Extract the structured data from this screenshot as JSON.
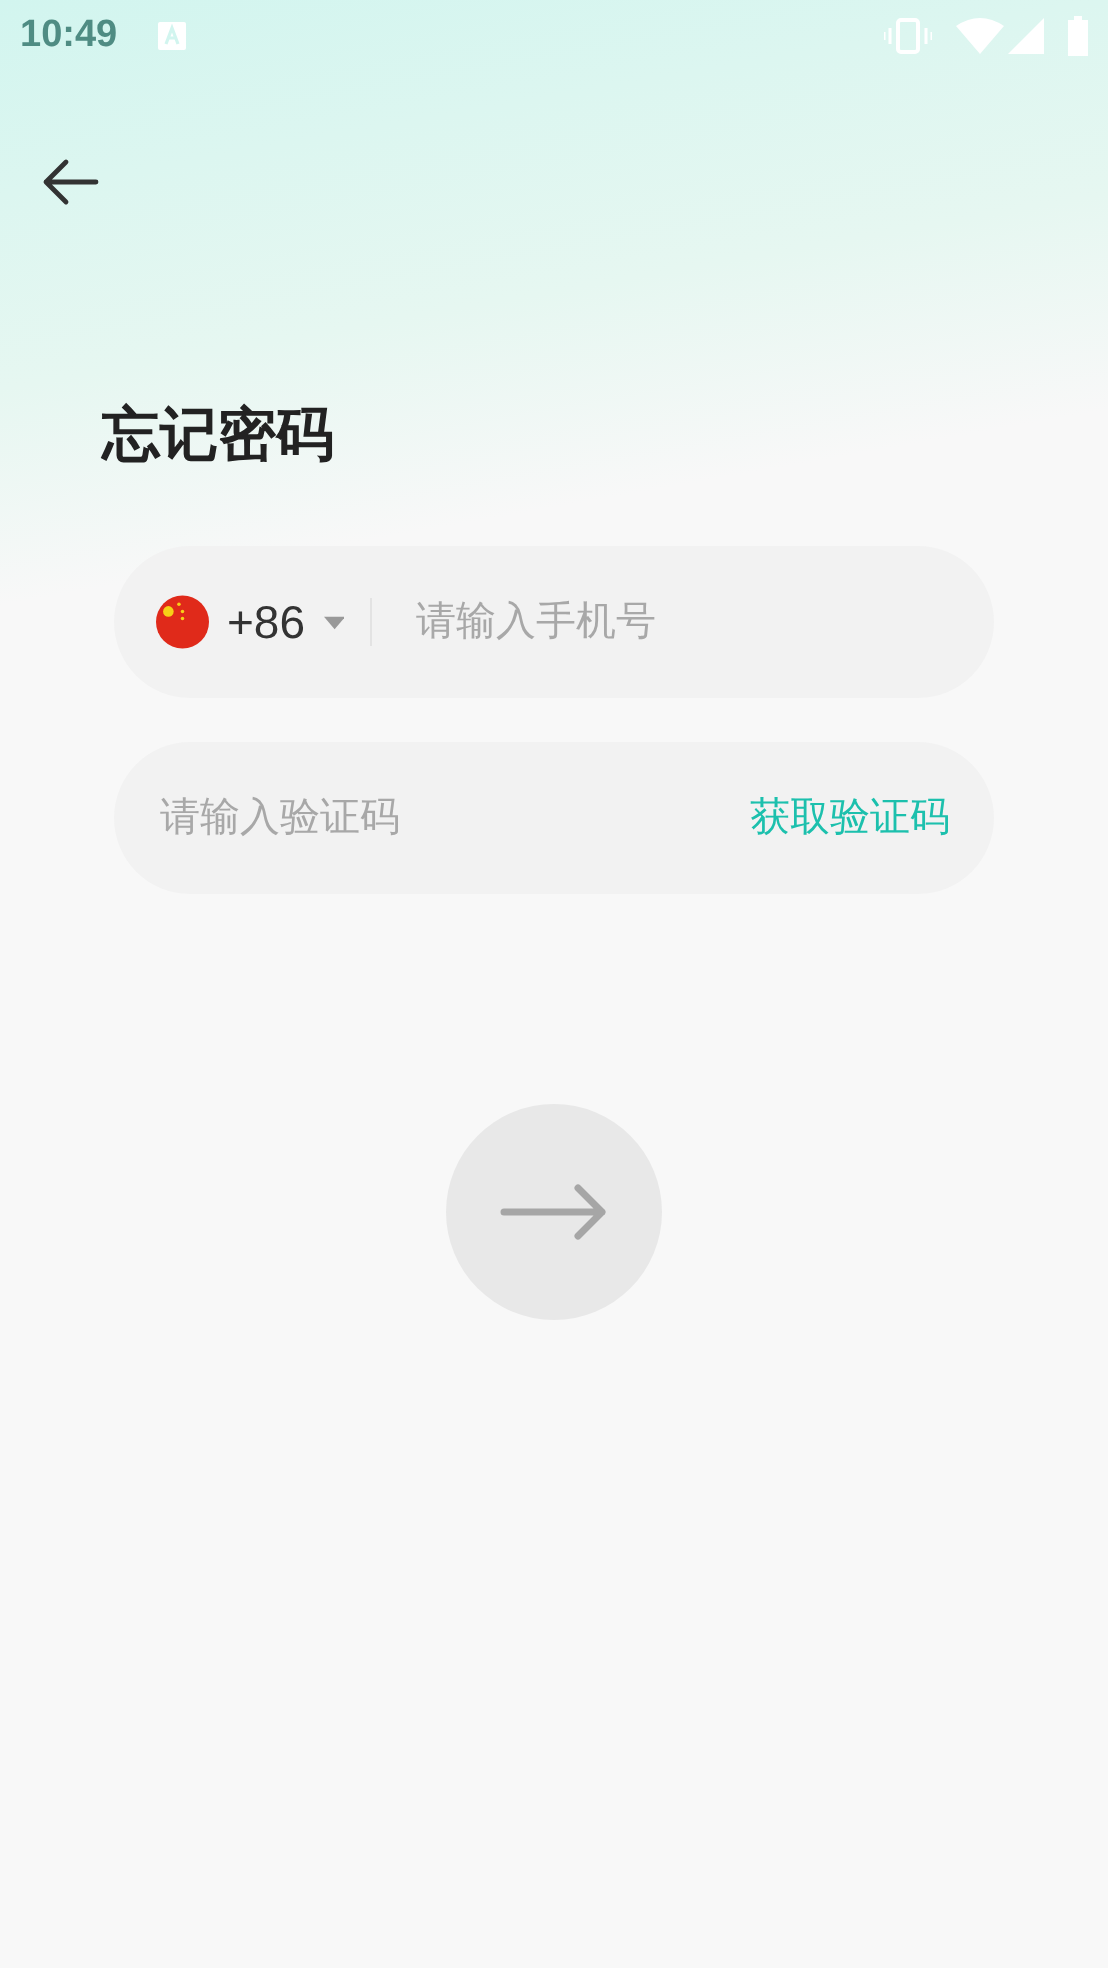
{
  "status_bar": {
    "time": "10:49"
  },
  "title": "忘记密码",
  "phone_field": {
    "country_code": "+86",
    "placeholder": "请输入手机号"
  },
  "code_field": {
    "placeholder": "请输入验证码",
    "action": "获取验证码"
  },
  "submit_button": {
    "disabled": true
  }
}
